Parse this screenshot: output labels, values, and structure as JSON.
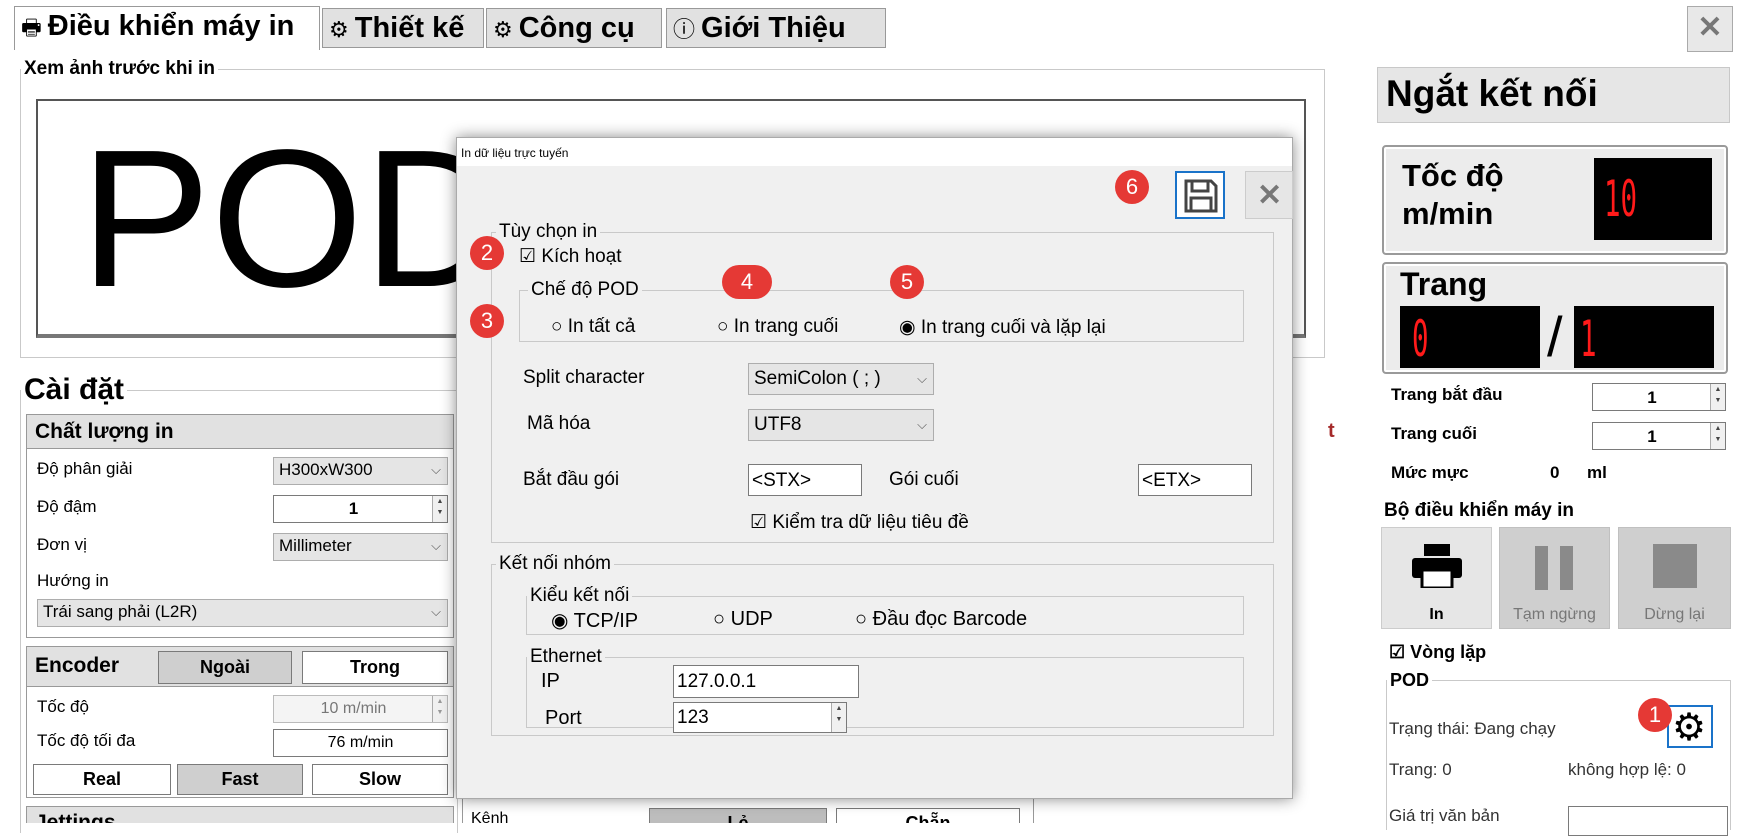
{
  "tabs": [
    {
      "label": "Điều khiển máy in",
      "icon": "🖶"
    },
    {
      "label": "Thiết kế",
      "icon": "⚙"
    },
    {
      "label": "Công cụ",
      "icon": "⚙"
    },
    {
      "label": "Giới Thiệu",
      "icon": "ⓘ"
    }
  ],
  "close_glyph": "✕",
  "preview": {
    "title": "Xem ảnh trước khi in",
    "text": "POD",
    "edge_text": "t"
  },
  "settings": {
    "title": "Cài đặt",
    "quality": {
      "title": "Chất lượng in",
      "resolution_label": "Độ phân giải",
      "resolution_value": "H300xW300",
      "density_label": "Độ đậm",
      "density_value": "1",
      "unit_label": "Đơn vị",
      "unit_value": "Millimeter",
      "direction_label": "Hướng in",
      "direction_value": "Trái sang phải (L2R)"
    },
    "encoder": {
      "title": "Encoder",
      "external": "Ngoài",
      "internal": "Trong",
      "speed_label": "Tốc độ",
      "speed_value": "10 m/min",
      "max_speed_label": "Tốc độ tối đa",
      "max_speed_value": "76 m/min",
      "real": "Real",
      "fast": "Fast",
      "slow": "Slow"
    },
    "jettings_label": "Jettings"
  },
  "bottom_partial": {
    "channel_label": "Kênh",
    "odd": "Lẻ",
    "even": "Chẵn"
  },
  "right": {
    "disconnect": "Ngắt kết nối",
    "speed_label_1": "Tốc độ",
    "speed_label_2": "m/min",
    "speed_value": "10",
    "page_label": "Trang",
    "page_current": "0",
    "page_sep": "/",
    "page_total": "1",
    "start_page_label": "Trang bắt đầu",
    "start_page_value": "1",
    "end_page_label": "Trang cuối",
    "end_page_value": "1",
    "ink_label": "Mức mực",
    "ink_value": "0",
    "ink_unit": "ml",
    "controller_title": "Bộ điều khiển máy in",
    "print": "In",
    "pause": "Tạm ngừng",
    "stop": "Dừng lại",
    "loop_label": "Vòng lặp",
    "pod_title": "POD",
    "status": "Trạng thái: Đang chạy",
    "pages": "Trang: 0",
    "invalid": "không hợp lệ: 0",
    "text_value_label": "Giá trị văn bản"
  },
  "dialog": {
    "title": "In dữ liệu trực tuyến",
    "print_options": "Tùy chọn in",
    "enable": "Kích hoạt",
    "pod_mode": "Chế độ POD",
    "mode_all": "In tất cả",
    "mode_last": "In trang cuối",
    "mode_last_repeat": "In trang cuối và lặp lại",
    "split_label": "Split character",
    "split_value": "SemiColon ( ; )",
    "encoding_label": "Mã hóa",
    "encoding_value": "UTF8",
    "start_packet_label": "Bắt đầu gói",
    "start_packet_value": "<STX>",
    "end_packet_label": "Gói cuối",
    "end_packet_value": "<ETX>",
    "check_header": "Kiểm tra dữ liệu tiêu đề",
    "group_connection": "Kết nối nhóm",
    "connection_type": "Kiểu kết nối",
    "tcp": "TCP/IP",
    "udp": "UDP",
    "barcode": "Đầu đọc Barcode",
    "ethernet": "Ethernet",
    "ip_label": "IP",
    "ip_value": "127.0.0.1",
    "port_label": "Port",
    "port_value": "123"
  },
  "badges": [
    "1",
    "2",
    "3",
    "4",
    "5",
    "6"
  ]
}
